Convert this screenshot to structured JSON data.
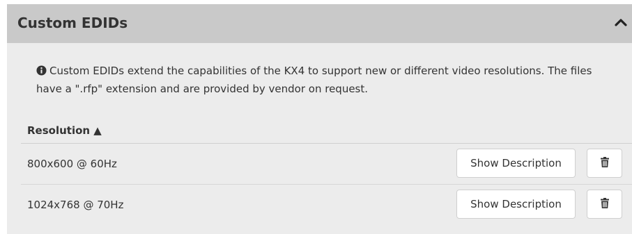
{
  "panel": {
    "title": "Custom EDIDs",
    "collapse_icon": "chevron-up-icon"
  },
  "info": {
    "icon": "info-circle-icon",
    "text": "Custom EDIDs extend the capabilities of the KX4 to support new or different video resolutions. The files have a \".rfp\" extension and are provided by vendor on request."
  },
  "table": {
    "column_header": "Resolution ▲",
    "rows": [
      {
        "resolution": "800x600 @ 60Hz",
        "show_label": "Show Description",
        "delete_icon": "trash-icon"
      },
      {
        "resolution": "1024x768 @ 70Hz",
        "show_label": "Show Description",
        "delete_icon": "trash-icon"
      }
    ]
  },
  "colors": {
    "header_bg": "#c9c9c9",
    "panel_bg": "#ececec",
    "text": "#333333"
  }
}
